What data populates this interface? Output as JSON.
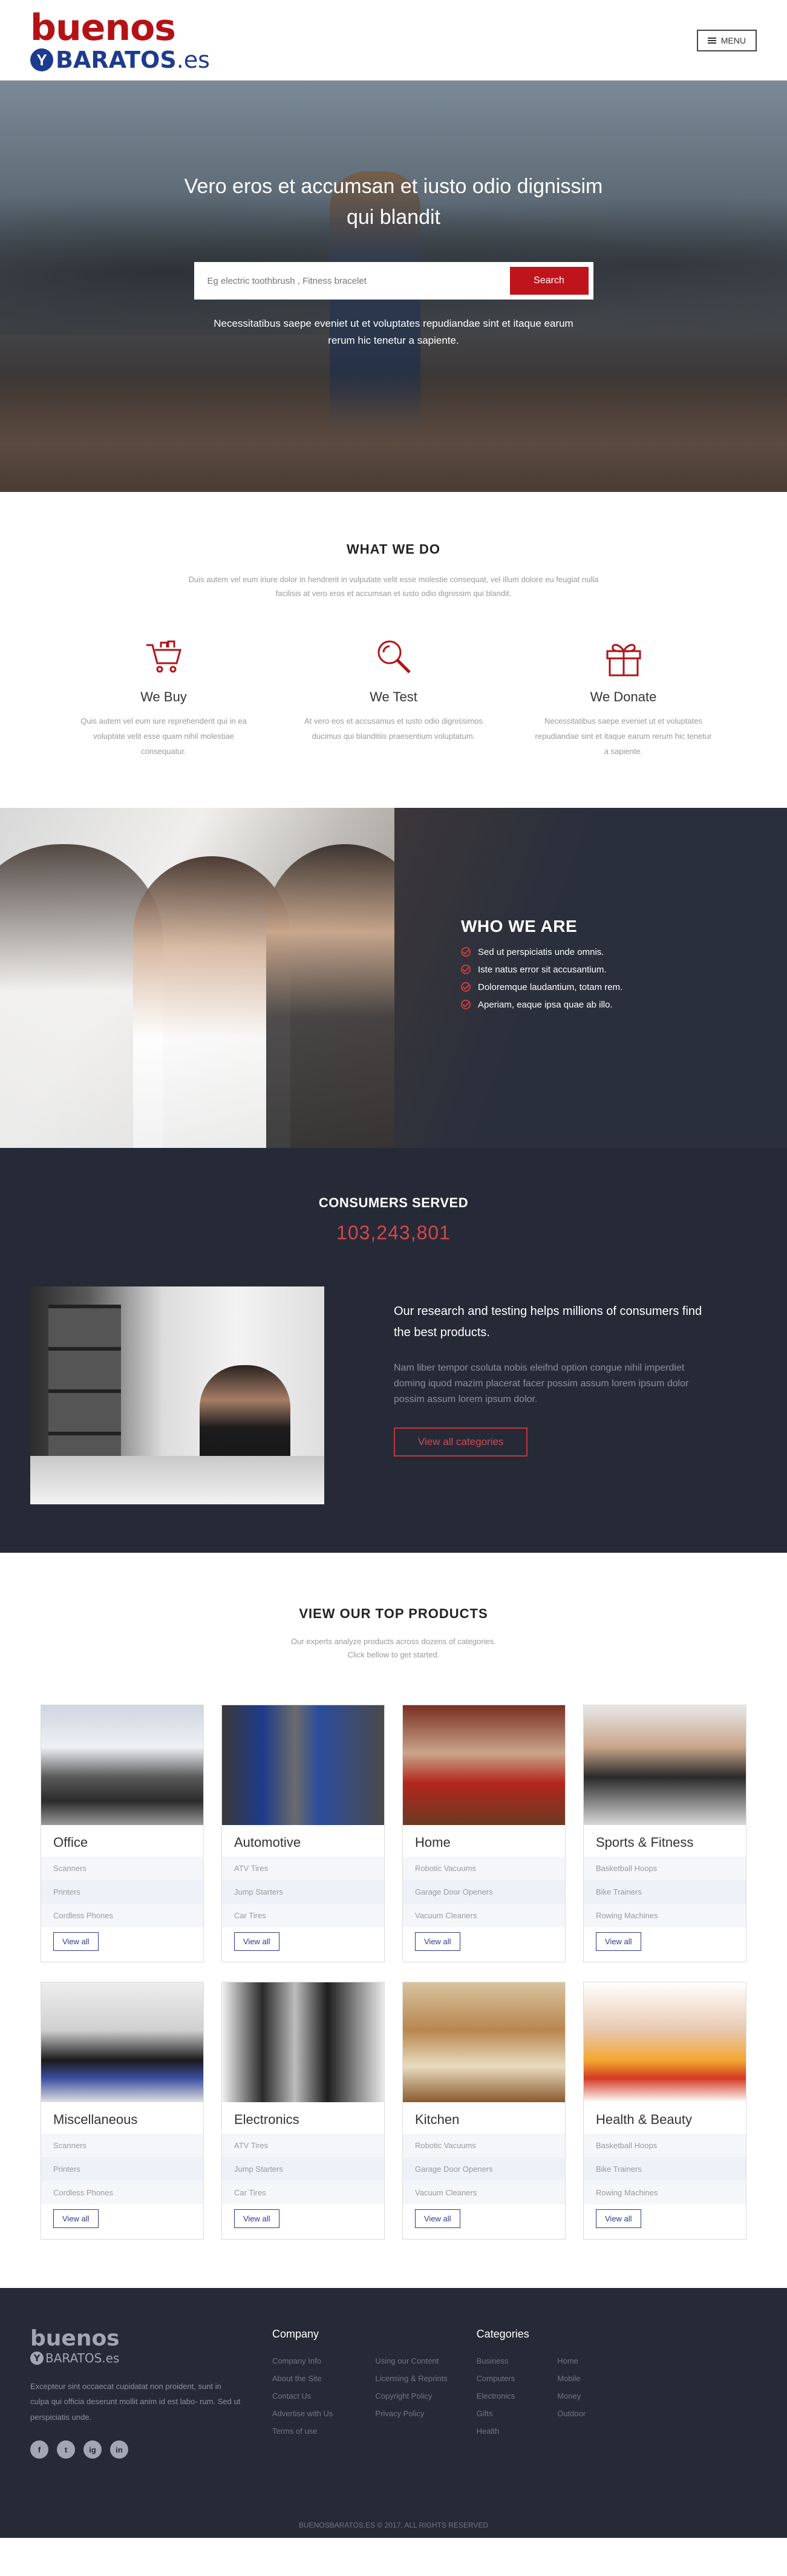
{
  "header": {
    "logo_top": "buenos",
    "logo_y": "Y",
    "logo_baratos": "BARATOS",
    "logo_es": ".es",
    "menu_label": "MENU"
  },
  "hero": {
    "title": "Vero eros et accumsan et iusto odio dignissim qui blandit",
    "search_placeholder": "Eg electric toothbrush , Fitness bracelet",
    "search_button": "Search",
    "subtitle": "Necessitatibus saepe eveniet ut et voluptates repudiandae sint et itaque earum rerum hic tenetur a sapiente."
  },
  "what_we_do": {
    "title": "WHAT WE DO",
    "subtitle": "Duis autem vel eum iriure dolor in hendrerit in vulputate velit esse molestie consequat, vel illum dolore eu feugiat nulla facilisis at vero eros et accumsan et iusto odio dignissim qui blandit.",
    "features": [
      {
        "icon": "cart-icon",
        "title": "We Buy",
        "text": "Quis autem vel eum iure reprehenderit qui in ea voluptate velit esse quam nihil molestiae consequatur."
      },
      {
        "icon": "search-icon",
        "title": "We Test",
        "text": "At vero eos et accusamus et iusto odio dignissimos ducimus qui blanditiis praesentium voluptatum."
      },
      {
        "icon": "gift-icon",
        "title": "We Donate",
        "text": "Necessitatibus saepe eveniet ut et voluptates repudiandae sint et itaque earum rerum hic tenetur a sapiente."
      }
    ]
  },
  "who_we_are": {
    "title": "WHO WE ARE",
    "items": [
      "Sed ut perspiciatis unde omnis.",
      "Iste natus error sit accusantium.",
      "Doloremque laudantium, totam rem.",
      "Aperiam, eaque ipsa quae ab illo."
    ],
    "accent": "#d03a3a"
  },
  "consumers": {
    "title": "CONSUMERS SERVED",
    "number": "103,243,801",
    "heading": "Our research and testing helps millions of consumers find the best products.",
    "body": "Nam liber tempor csoluta nobis eleifnd option congue nihil imperdiet doming iquod mazim placerat facer possim assum lorem ipsum dolor possim assum lorem ipsum dolor.",
    "button": "View all categories"
  },
  "products": {
    "title": "VIEW OUR TOP PRODUCTS",
    "subtitle_line1": "Our experts analyze products across dozens of categories.",
    "subtitle_line2": "Click bellow to get started.",
    "cards": [
      {
        "title": "Office",
        "items": [
          "Scanners",
          "Printers",
          "Cordless Phones"
        ],
        "button": "View all"
      },
      {
        "title": "Automotive",
        "items": [
          "ATV Tires",
          "Jump Starters",
          "Car Tires"
        ],
        "button": "View all"
      },
      {
        "title": "Home",
        "items": [
          "Robotic Vacuums",
          "Garage Door Openers",
          "Vacuum Cleaners"
        ],
        "button": "View all"
      },
      {
        "title": "Sports & Fitness",
        "items": [
          "Basketball Hoops",
          "Bike Trainers",
          "Rowing Machines"
        ],
        "button": "View all"
      },
      {
        "title": "Miscellaneous",
        "items": [
          "Scanners",
          "Printers",
          "Cordless Phones"
        ],
        "button": "View all"
      },
      {
        "title": "Electronics",
        "items": [
          "ATV Tires",
          "Jump Starters",
          "Car Tires"
        ],
        "button": "View all"
      },
      {
        "title": "Kitchen",
        "items": [
          "Robotic Vacuums",
          "Garage Door Openers",
          "Vacuum Cleaners"
        ],
        "button": "View all"
      },
      {
        "title": "Health & Beauty",
        "items": [
          "Basketball Hoops",
          "Bike Trainers",
          "Rowing Machines"
        ],
        "button": "View all"
      }
    ]
  },
  "footer": {
    "logo_top": "buenos",
    "logo_y": "Y",
    "logo_bottom": "BARATOS.es",
    "about": "Excepteur sint occaecat cupidatat non proident, sunt in culpa qui officia deserunt mollit anim id est labo- rum. Sed ut perspiciatis unde.",
    "social": [
      "f",
      "t",
      "ig",
      "in"
    ],
    "company_title": "Company",
    "company_col1": [
      "Company Info",
      "About the Site",
      "Contact Us",
      "Advertise with Us",
      "Terms of use"
    ],
    "company_col2": [
      "Using our Content",
      "Licensing & Reprints",
      "Copyright Policy",
      "Privacy Policy"
    ],
    "categories_title": "Categories",
    "categories_col1": [
      "Business",
      "Computers",
      "Electronics",
      "Gifts",
      "Health"
    ],
    "categories_col2": [
      "Home",
      "Mobile",
      "Money",
      "Outdoor"
    ],
    "copyright": "BUENOSBARATOS.ES © 2017. ALL RIGHTS RESERVED"
  }
}
